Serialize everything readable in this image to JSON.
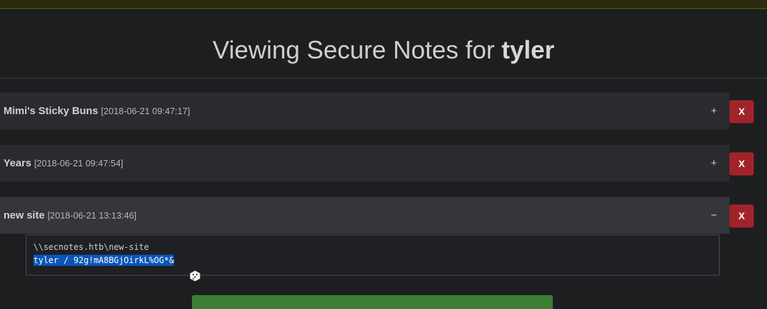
{
  "heading": {
    "prefix": "Viewing Secure Notes for ",
    "user": "tyler"
  },
  "notes": [
    {
      "title": "Mimi's Sticky Buns",
      "date": "[2018-06-21 09:47:17]",
      "toggle": "+",
      "delete_label": "X"
    },
    {
      "title": "Years",
      "date": "[2018-06-21 09:47:54]",
      "toggle": "+",
      "delete_label": "X"
    },
    {
      "title": "new site",
      "date": "[2018-06-21 13:13:46]",
      "toggle": "−",
      "delete_label": "X"
    }
  ],
  "open_note": {
    "line1": "\\\\secnotes.htb\\new-site",
    "line2": "tyler / 92g!mA8BGjOirkL%OG*&"
  },
  "colors": {
    "delete": "#a1232a",
    "selection": "#0a55b8",
    "action": "#3d7d34"
  },
  "icons": {
    "cursor": "dice-cursor-icon"
  }
}
